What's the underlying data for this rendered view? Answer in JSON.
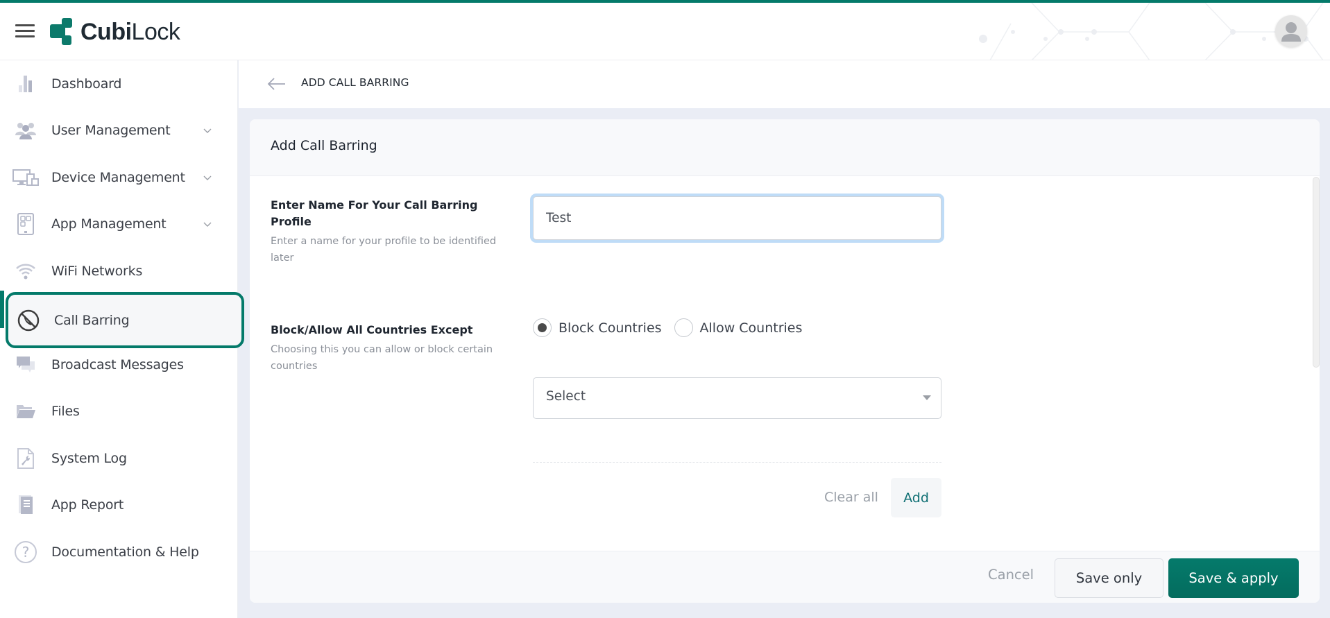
{
  "app": {
    "brand_bold": "Cubi",
    "brand_light": "Lock",
    "accent_color": "#047a6a",
    "focus_ring_color": "#bfdcf7"
  },
  "header": {
    "menu_icon": "hamburger-icon",
    "avatar_icon": "user-avatar-icon"
  },
  "sidebar": {
    "items": [
      {
        "label": "Dashboard",
        "icon": "bar-chart-icon",
        "expandable": false,
        "active": false
      },
      {
        "label": "User Management",
        "icon": "users-icon",
        "expandable": true,
        "active": false
      },
      {
        "label": "Device Management",
        "icon": "devices-icon",
        "expandable": true,
        "active": false
      },
      {
        "label": "App Management",
        "icon": "tablet-apps-icon",
        "expandable": true,
        "active": false
      },
      {
        "label": "WiFi Networks",
        "icon": "wifi-icon",
        "expandable": false,
        "active": false
      },
      {
        "label": "Call Barring",
        "icon": "call-barring-icon",
        "expandable": false,
        "active": true
      },
      {
        "label": "Broadcast Messages",
        "icon": "chat-bubbles-icon",
        "expandable": false,
        "active": false
      },
      {
        "label": "Files",
        "icon": "folder-icon",
        "expandable": false,
        "active": false
      },
      {
        "label": "System Log",
        "icon": "wrench-document-icon",
        "expandable": false,
        "active": false
      },
      {
        "label": "App Report",
        "icon": "report-icon",
        "expandable": false,
        "active": false
      },
      {
        "label": "Documentation & Help",
        "icon": "help-circle-icon",
        "expandable": false,
        "active": false
      }
    ]
  },
  "page": {
    "title": "ADD CALL BARRING",
    "back_icon": "arrow-left-icon"
  },
  "card": {
    "title": "Add Call Barring",
    "name_field": {
      "label": "Enter Name For Your Call Barring Profile",
      "help": "Enter a name for your profile to be identified later",
      "value": "Test"
    },
    "countries_field": {
      "label": "Block/Allow All Countries Except",
      "help": "Choosing this you can allow or block certain countries",
      "options": [
        {
          "label": "Block Countries",
          "checked": true
        },
        {
          "label": "Allow Countries",
          "checked": false
        }
      ],
      "select_placeholder": "Select",
      "clear_all_label": "Clear all",
      "add_label": "Add"
    },
    "footer": {
      "cancel_label": "Cancel",
      "save_only_label": "Save only",
      "save_apply_label": "Save & apply"
    }
  }
}
